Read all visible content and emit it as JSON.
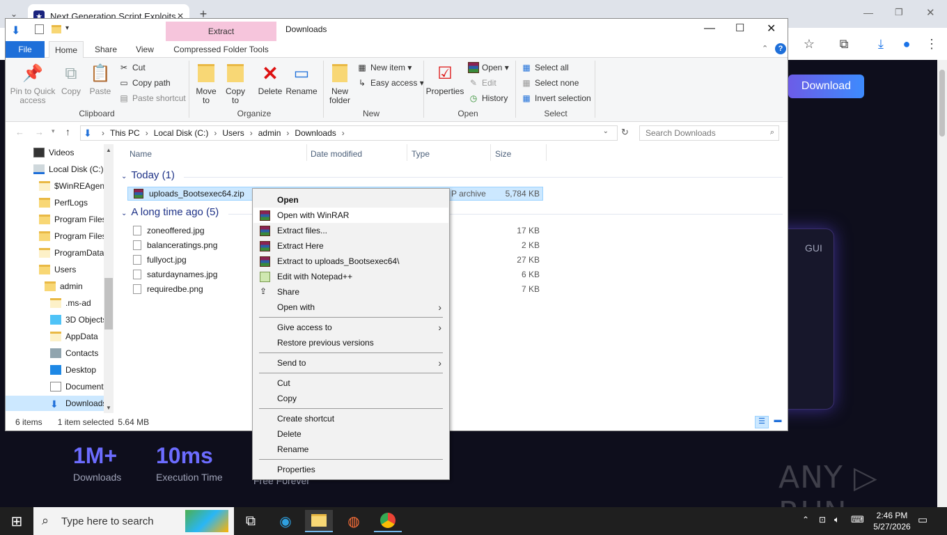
{
  "browser": {
    "tab_title": "Next Generation Script Exploits",
    "tab_close": "✕",
    "new_tab": "+"
  },
  "site": {
    "download_button": "Download",
    "gui_label": "GUI",
    "stats": [
      {
        "value": "1M+",
        "label": "Downloads"
      },
      {
        "value": "10ms",
        "label": "Execution Time"
      }
    ],
    "partial_text": "Free Forever",
    "watermark": "ANY ▷ RUN"
  },
  "explorer": {
    "context_tab": "Extract",
    "window_title": "Downloads",
    "ribbon_tabs": [
      "File",
      "Home",
      "Share",
      "View",
      "Compressed Folder Tools"
    ],
    "ribbon": {
      "clipboard": {
        "pin": "Pin to Quick access",
        "copy": "Copy",
        "paste": "Paste",
        "cut": "Cut",
        "copy_path": "Copy path",
        "paste_shortcut": "Paste shortcut",
        "label": "Clipboard"
      },
      "organize": {
        "move_to": "Move to",
        "copy_to": "Copy to",
        "delete": "Delete",
        "rename": "Rename",
        "label": "Organize"
      },
      "new": {
        "new_folder": "New folder",
        "new_item": "New item",
        "easy_access": "Easy access",
        "label": "New"
      },
      "open": {
        "properties": "Properties",
        "open": "Open",
        "edit": "Edit",
        "history": "History",
        "label": "Open"
      },
      "select": {
        "select_all": "Select all",
        "select_none": "Select none",
        "invert": "Invert selection",
        "label": "Select"
      }
    },
    "breadcrumb": [
      "This PC",
      "Local Disk (C:)",
      "Users",
      "admin",
      "Downloads"
    ],
    "search_placeholder": "Search Downloads",
    "nav_items": [
      {
        "label": "Videos",
        "indent": 0
      },
      {
        "label": "Local Disk (C:)",
        "indent": 0
      },
      {
        "label": "$WinREAgent",
        "indent": 1
      },
      {
        "label": "PerfLogs",
        "indent": 1
      },
      {
        "label": "Program Files",
        "indent": 1
      },
      {
        "label": "Program Files",
        "indent": 1
      },
      {
        "label": "ProgramData",
        "indent": 1
      },
      {
        "label": "Users",
        "indent": 1
      },
      {
        "label": "admin",
        "indent": 2
      },
      {
        "label": ".ms-ad",
        "indent": 3
      },
      {
        "label": "3D Objects",
        "indent": 3
      },
      {
        "label": "AppData",
        "indent": 3
      },
      {
        "label": "Contacts",
        "indent": 3
      },
      {
        "label": "Desktop",
        "indent": 3
      },
      {
        "label": "Documents",
        "indent": 3
      },
      {
        "label": "Downloads",
        "indent": 3
      }
    ],
    "columns": [
      "Name",
      "Date modified",
      "Type",
      "Size"
    ],
    "groups": {
      "today": "Today (1)",
      "long_ago": "A long time ago (5)"
    },
    "selected_file": {
      "name": "uploads_Bootsexec64.zip",
      "type": "P archive",
      "size": "5,784 KB"
    },
    "files": [
      {
        "name": "zoneoffered.jpg",
        "size": "17 KB"
      },
      {
        "name": "balanceratings.png",
        "size": "2 KB"
      },
      {
        "name": "fullyoct.jpg",
        "size": "27 KB"
      },
      {
        "name": "saturdaynames.jpg",
        "size": "6 KB"
      },
      {
        "name": "requiredbe.png",
        "size": "7 KB"
      }
    ],
    "status": {
      "count": "6 items",
      "selected": "1 item selected",
      "size": "5.64 MB"
    }
  },
  "context_menu": [
    {
      "label": "Open",
      "bold": true
    },
    {
      "label": "Open with WinRAR",
      "icon": "winrar-icon"
    },
    {
      "label": "Extract files...",
      "icon": "winrar-icon"
    },
    {
      "label": "Extract Here",
      "icon": "winrar-icon"
    },
    {
      "label": "Extract to uploads_Bootsexec64\\",
      "icon": "winrar-icon"
    },
    {
      "label": "Edit with Notepad++",
      "icon": "notepad-icon"
    },
    {
      "label": "Share",
      "icon": "share-icon"
    },
    {
      "label": "Open with",
      "submenu": true
    },
    {
      "label": "Give access to",
      "submenu": true
    },
    {
      "label": "Restore previous versions"
    },
    {
      "label": "Send to",
      "submenu": true
    },
    {
      "label": "Cut"
    },
    {
      "label": "Copy"
    },
    {
      "label": "Create shortcut"
    },
    {
      "label": "Delete"
    },
    {
      "label": "Rename"
    },
    {
      "label": "Properties"
    }
  ],
  "taskbar": {
    "search_placeholder": "Type here to search",
    "time": "2:46 PM",
    "date": "5/27/2026"
  }
}
